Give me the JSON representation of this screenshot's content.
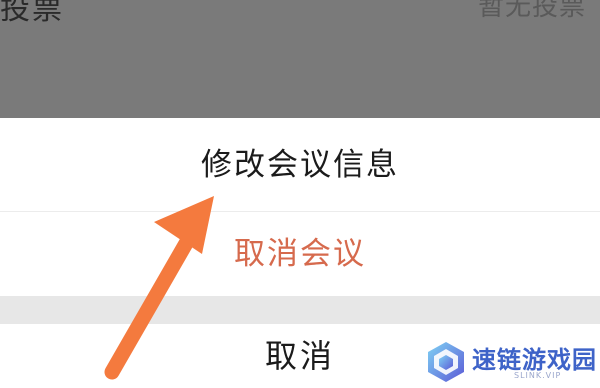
{
  "background": {
    "left_text": "投票",
    "right_text": "暂无投票"
  },
  "action_sheet": {
    "items": [
      {
        "label": "修改会议信息",
        "color": "#1b1b1b"
      },
      {
        "label": "取消会议",
        "color": "#d66a4d"
      }
    ],
    "cancel_label": "取消"
  },
  "annotation": {
    "arrow_color": "#f47a3e"
  },
  "watermark": {
    "text": "速链游戏园",
    "sub": "SLINK.VIP",
    "color": "#3e63c8"
  }
}
